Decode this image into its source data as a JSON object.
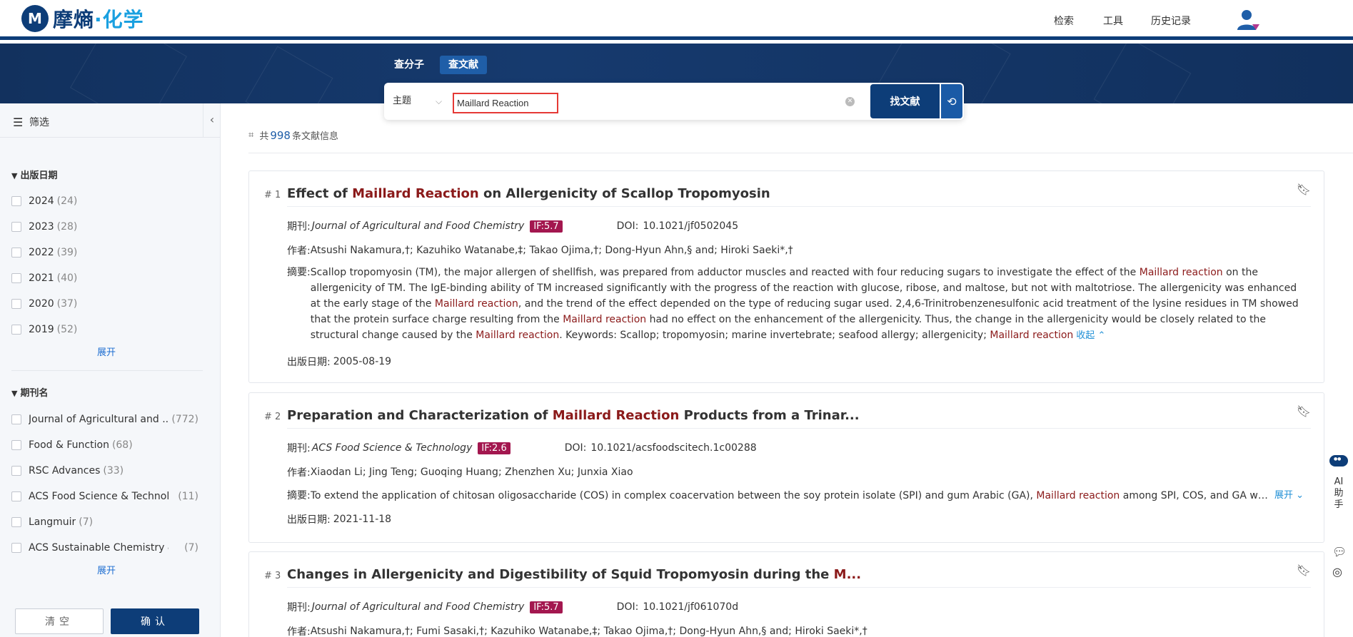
{
  "header": {
    "logo_mark": "M",
    "logo_main": "摩熵",
    "logo_accent": "·化学",
    "nav": [
      "检索",
      "工具",
      "历史记录"
    ]
  },
  "search": {
    "tabs": [
      "查分子",
      "查文献"
    ],
    "active_tab": "查文献",
    "field": "主题",
    "query": "Maillard Reaction",
    "button": "找文献"
  },
  "sidebar": {
    "title": "筛选",
    "date_group": "出版日期",
    "years": [
      {
        "label": "2024",
        "count": "(24)"
      },
      {
        "label": "2023",
        "count": "(28)"
      },
      {
        "label": "2022",
        "count": "(39)"
      },
      {
        "label": "2021",
        "count": "(40)"
      },
      {
        "label": "2020",
        "count": "(37)"
      },
      {
        "label": "2019",
        "count": "(52)"
      }
    ],
    "journal_group": "期刊名",
    "journals": [
      {
        "label": "Journal of Agricultural and ...",
        "count": "(772)"
      },
      {
        "label": "Food & Function",
        "count": "(68)"
      },
      {
        "label": "RSC Advances",
        "count": "(33)"
      },
      {
        "label": "ACS Food Science & Technol...",
        "count": "(11)"
      },
      {
        "label": "Langmuir",
        "count": "(7)"
      },
      {
        "label": "ACS Sustainable Chemistry & ...",
        "count": "(7)"
      }
    ],
    "expand": "展开",
    "clear": "清空",
    "confirm": "确认"
  },
  "results": {
    "prefix": "共",
    "total": "998",
    "suffix": "条文献信息",
    "labels": {
      "journal": "期刊:",
      "doi": "DOI:",
      "authors": "作者:",
      "abstract": "摘要:",
      "date": "出版日期:",
      "collapse": "收起",
      "expand": "展开"
    },
    "items": [
      {
        "index": "# 1",
        "title_pre": "Effect of ",
        "title_hl": "Maillard Reaction",
        "title_post": " on Allergenicity of Scallop Tropomyosin",
        "journal": "Journal of Agricultural and Food Chemistry",
        "if": "IF:5.7",
        "doi": "10.1021/jf0502045",
        "authors": "Atsushi Nakamura,†; Kazuhiko Watanabe,‡; Takao Ojima,†; Dong-Hyun Ahn,§ and; Hiroki Saeki*,†",
        "abstract_parts": [
          "Scallop tropomyosin (TM), the major allergen of shellfish, was prepared from adductor muscles and reacted with four reducing sugars to investigate the effect of the ",
          "Maillard reaction",
          " on the allergenicity of TM. The IgE-binding ability of TM increased significantly with the progress of the reaction with glucose, ribose, and maltose, but not with maltotriose. The allergenicity was enhanced at the early stage of the ",
          "Maillard reaction",
          ", and the trend of the effect depended on the type of reducing sugar used. 2,4,6-Trinitrobenzenesulfonic acid treatment of the lysine residues in TM showed that the protein surface charge resulting from the ",
          "Maillard reaction",
          " had no effect on the enhancement of the allergenicity. Thus, the change in the allergenicity would be closely related to the structural change caused by the ",
          "Maillard reaction",
          ". Keywords: Scallop; tropomyosin; marine invertebrate; seafood allergy; allergenicity; ",
          "Maillard reaction"
        ],
        "date": "2005-08-19"
      },
      {
        "index": "# 2",
        "title_pre": "Preparation and Characterization of ",
        "title_hl": "Maillard Reaction",
        "title_post": " Products from a Trinar...",
        "journal": "ACS Food Science & Technology",
        "if": "IF:2.6",
        "doi": "10.1021/acsfoodscitech.1c00288",
        "authors": "Xiaodan Li; Jing Teng; Guoqing Huang; Zhenzhen Xu; Junxia Xiao",
        "abstract_parts": [
          "To extend the application of chitosan oligosaccharide (COS) in complex coacervation between the soy protein isolate (SPI) and gum Arabic (GA), ",
          "Maillard reaction",
          " among SPI, COS, and GA was induce..."
        ],
        "date": "2021-11-18"
      },
      {
        "index": "# 3",
        "title_pre": "Changes in Allergenicity and Digestibility of Squid Tropomyosin during the ",
        "title_hl": "M...",
        "title_post": "",
        "journal": "Journal of Agricultural and Food Chemistry",
        "if": "IF:5.7",
        "doi": "10.1021/jf061070d",
        "authors": "Atsushi Nakamura,†; Fumi Sasaki,†; Kazuhiko Watanabe,‡; Takao Ojima,†; Dong-Hyun Ahn,§ and; Hiroki Saeki*,†"
      }
    ]
  },
  "assistant": {
    "label": "AI助手"
  },
  "colors": {
    "brand": "#0d3d78",
    "highlight": "#8b1a1a",
    "if_badge": "#a3174f",
    "link": "#1f8fd6"
  }
}
